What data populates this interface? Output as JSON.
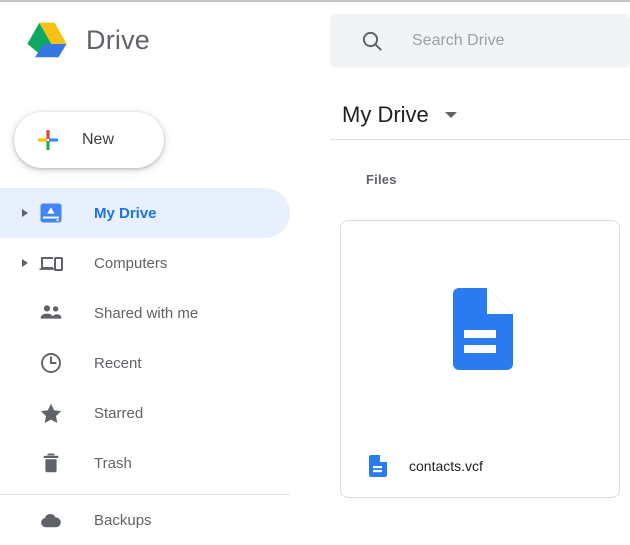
{
  "app": {
    "product_name": "Drive",
    "logo_colors": {
      "green": "#0da960",
      "yellow": "#f7c116",
      "blue": "#3777e3"
    }
  },
  "sidebar": {
    "new_button": {
      "label": "New",
      "icon": "plus-icon",
      "plus_colors": {
        "red": "#ea4335",
        "yellow": "#fbbc05",
        "blue": "#4285f4",
        "green": "#34a853"
      }
    },
    "items": [
      {
        "label": "My Drive",
        "icon": "my-drive-icon",
        "expandable": true,
        "selected": true
      },
      {
        "label": "Computers",
        "icon": "computers-icon",
        "expandable": true,
        "selected": false
      },
      {
        "label": "Shared with me",
        "icon": "people-icon",
        "expandable": false,
        "selected": false
      },
      {
        "label": "Recent",
        "icon": "clock-icon",
        "expandable": false,
        "selected": false
      },
      {
        "label": "Starred",
        "icon": "star-icon",
        "expandable": false,
        "selected": false
      },
      {
        "label": "Trash",
        "icon": "trash-icon",
        "expandable": false,
        "selected": false
      }
    ],
    "items_after_divider": [
      {
        "label": "Backups",
        "icon": "cloud-icon",
        "expandable": false,
        "selected": false
      }
    ],
    "selected_color": "#1a73e8",
    "selected_background": "#e8f0fe"
  },
  "search": {
    "placeholder": "Search Drive",
    "icon": "search-icon",
    "background": "#f1f3f4"
  },
  "main": {
    "breadcrumb": {
      "label": "My Drive",
      "dropdown_icon": "chevron-down-icon"
    },
    "section_label": "Files",
    "files": [
      {
        "name": "contacts.vcf",
        "thumb_icon": "document-icon",
        "small_icon": "document-icon",
        "icon_color": "#2a7bf0"
      }
    ]
  }
}
